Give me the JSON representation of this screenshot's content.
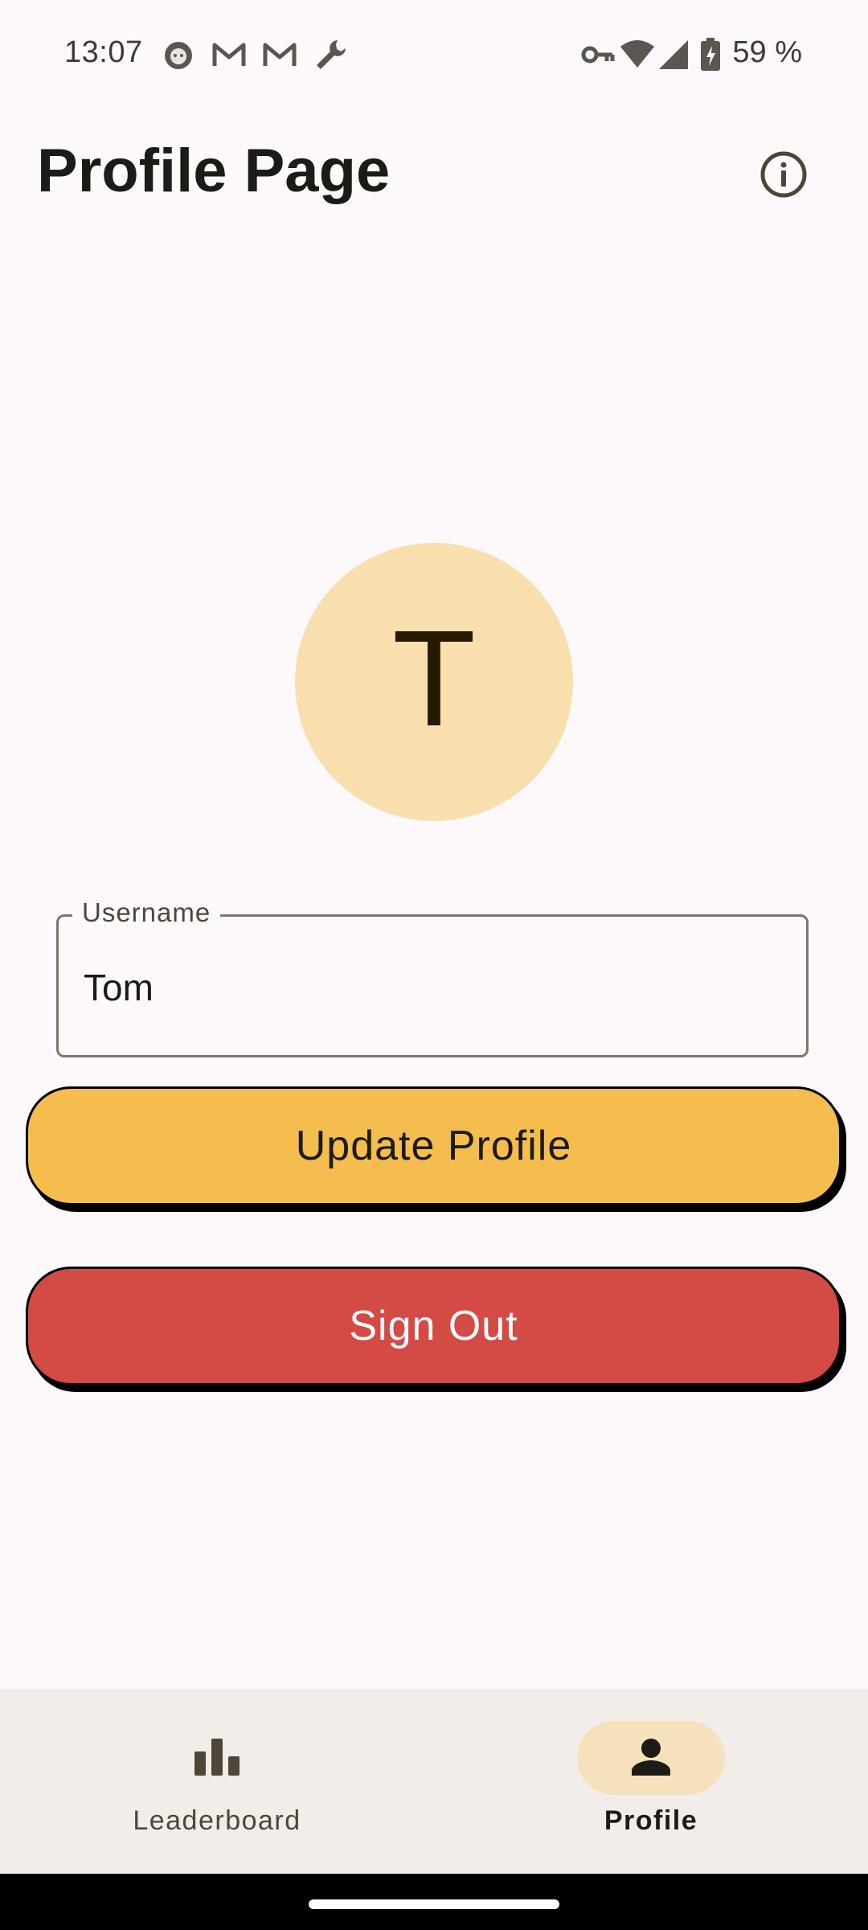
{
  "status_bar": {
    "time": "13:07",
    "battery_text": "59 %",
    "left_icons": [
      "cat-face-icon",
      "gmail-icon",
      "gmail-icon",
      "wrench-icon"
    ],
    "right_icons": [
      "vpn-key-icon",
      "wifi-icon",
      "cellular-signal-icon",
      "battery-charging-icon"
    ]
  },
  "header": {
    "title": "Profile Page",
    "info_icon": "info-icon"
  },
  "avatar": {
    "initial": "T",
    "background_color": "#F9DFAE"
  },
  "username_field": {
    "label": "Username",
    "value": "Tom"
  },
  "buttons": {
    "update_label": "Update Profile",
    "signout_label": "Sign Out",
    "update_color": "#F4BD4E",
    "signout_color": "#D44A45"
  },
  "bottom_nav": {
    "items": [
      {
        "label": "Leaderboard",
        "icon": "leaderboard-icon",
        "selected": false
      },
      {
        "label": "Profile",
        "icon": "person-icon",
        "selected": true
      }
    ]
  }
}
